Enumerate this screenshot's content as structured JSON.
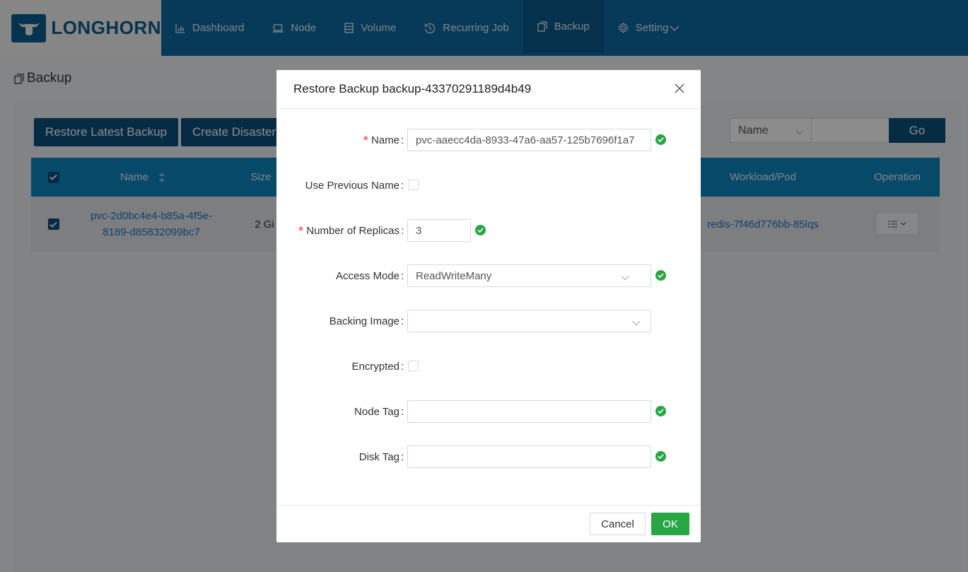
{
  "app": {
    "logo_text": "LONGHORN"
  },
  "nav": {
    "items": [
      {
        "label": "Dashboard",
        "icon": "bar-chart-icon"
      },
      {
        "label": "Node",
        "icon": "laptop-icon"
      },
      {
        "label": "Volume",
        "icon": "database-icon"
      },
      {
        "label": "Recurring Job",
        "icon": "clock-history-icon"
      },
      {
        "label": "Backup",
        "icon": "copy-icon",
        "active": true
      },
      {
        "label": "Setting",
        "icon": "gear-icon",
        "has_dropdown": true
      }
    ]
  },
  "page": {
    "title": "Backup",
    "buttons": {
      "restore_latest": "Restore Latest Backup",
      "create_disaster": "Create Disaster"
    },
    "search": {
      "field_selected": "Name",
      "go_label": "Go"
    }
  },
  "table": {
    "headers": {
      "name": "Name",
      "size": "Size",
      "workload": "Workload/Pod",
      "operation": "Operation"
    },
    "rows": [
      {
        "name": "pvc-2d0bc4e4-b85a-4f5e-8189-d85832099bc7",
        "name_line1": "pvc-2d0bc4e4-b85a-4f5e-",
        "name_line2": "8189-d85832099bc7",
        "size": "2 Gi",
        "workload": "redis-7f46d776bb-85lqs",
        "checked": true
      }
    ]
  },
  "modal": {
    "title": "Restore Backup backup-43370291189d4b49",
    "fields": {
      "name": {
        "label": "Name",
        "value": "pvc-aaecc4da-8933-47a6-aa57-125b7696f1a7",
        "required": true
      },
      "use_previous_name": {
        "label": "Use Previous Name",
        "checked": false
      },
      "replicas": {
        "label": "Number of Replicas",
        "value": "3",
        "required": true
      },
      "access_mode": {
        "label": "Access Mode",
        "value": "ReadWriteMany"
      },
      "backing_image": {
        "label": "Backing Image",
        "value": ""
      },
      "encrypted": {
        "label": "Encrypted",
        "checked": false
      },
      "node_tag": {
        "label": "Node Tag",
        "value": ""
      },
      "disk_tag": {
        "label": "Disk Tag",
        "value": ""
      }
    },
    "cancel_label": "Cancel",
    "ok_label": "OK"
  },
  "colors": {
    "nav_bg": "#0c6ba0",
    "primary": "#0b4f7e",
    "table_header": "#0c86c0",
    "success": "#27a644",
    "required": "#f5222d",
    "link": "#1a76c8"
  }
}
